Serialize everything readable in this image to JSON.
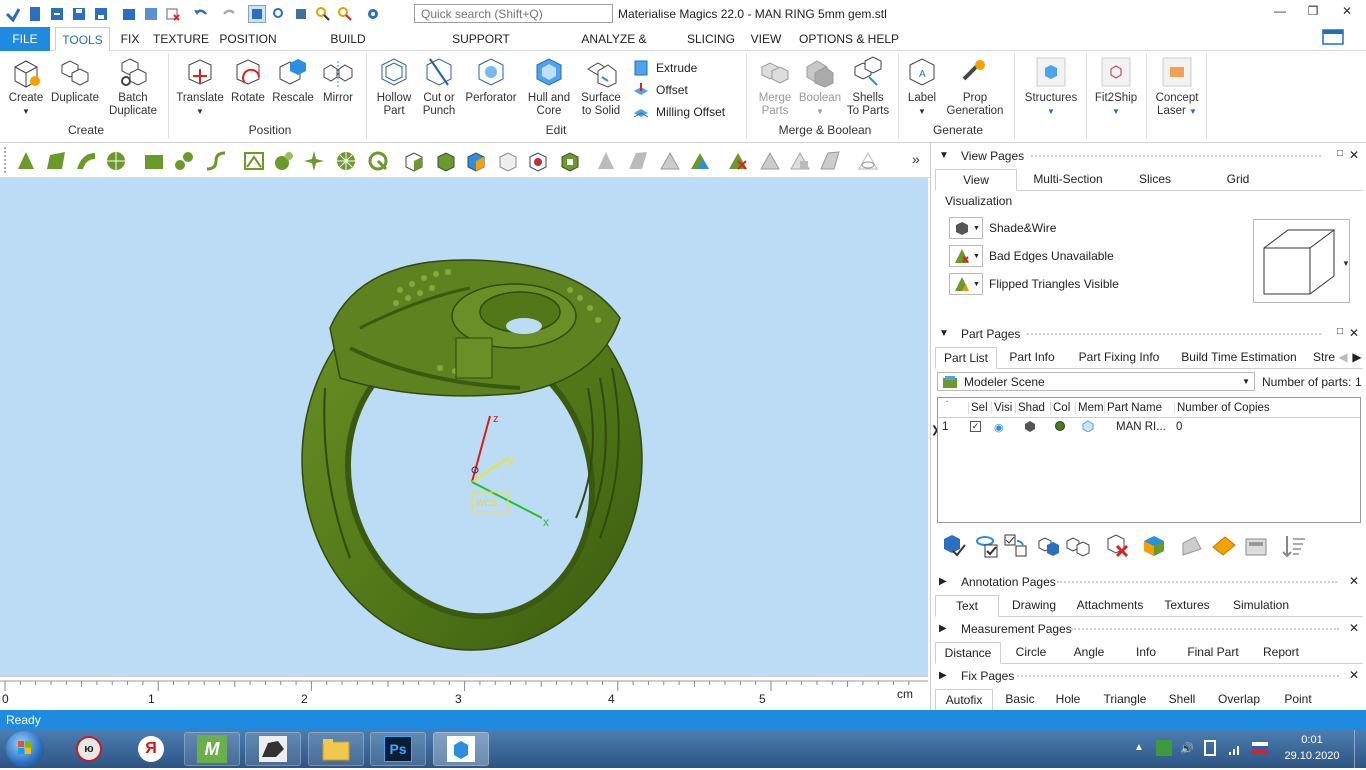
{
  "titlebar": {
    "search_placeholder": "Quick search (Shift+Q)",
    "title": "Materialise Magics 22.0 - MAN RING 5mm gem.stl"
  },
  "menu": {
    "file": "FILE",
    "tabs": [
      "TOOLS",
      "FIX",
      "TEXTURE",
      "POSITION",
      "BUILD PREPARATION",
      "SUPPORT GENERATION",
      "ANALYZE & REPORT",
      "SLICING",
      "VIEW",
      "OPTIONS & HELP"
    ]
  },
  "ribbon": {
    "create": {
      "group": "Create",
      "create": "Create",
      "duplicate": "Duplicate",
      "batch1": "Batch",
      "batch2": "Duplicate"
    },
    "position": {
      "group": "Position",
      "translate": "Translate",
      "rotate": "Rotate",
      "rescale": "Rescale",
      "mirror": "Mirror"
    },
    "edit": {
      "group": "Edit",
      "hollow1": "Hollow",
      "hollow2": "Part",
      "cut1": "Cut or",
      "cut2": "Punch",
      "perforator": "Perforator",
      "hull1": "Hull and",
      "hull2": "Core",
      "surf1": "Surface",
      "surf2": "to Solid",
      "extrude": "Extrude",
      "offset": "Offset",
      "milling": "Milling Offset"
    },
    "merge": {
      "group": "Merge & Boolean",
      "merge1": "Merge",
      "merge2": "Parts",
      "boolean": "Boolean",
      "shells1": "Shells",
      "shells2": "To Parts"
    },
    "generate": {
      "group": "Generate",
      "label": "Label",
      "prop1": "Prop",
      "prop2": "Generation"
    },
    "structures": "Structures",
    "fit2ship": "Fit2Ship",
    "concept1": "Concept",
    "concept2": "Laser"
  },
  "viewport": {
    "axis_x": "x",
    "axis_y": "y",
    "axis_z": "z",
    "wcs": "WCS"
  },
  "ruler": {
    "unit": "cm",
    "ticks": [
      "0",
      "1",
      "2",
      "3",
      "4",
      "5"
    ]
  },
  "view_pages": {
    "title": "View Pages",
    "tabs": [
      "View",
      "Multi-Section",
      "Slices",
      "Grid"
    ],
    "visualization": "Visualization",
    "shade": "Shade&Wire",
    "bad_edges": "Bad Edges Unavailable",
    "flipped": "Flipped Triangles Visible"
  },
  "part_pages": {
    "title": "Part Pages",
    "tabs": [
      "Part List",
      "Part Info",
      "Part Fixing Info",
      "Build Time Estimation",
      "Stre"
    ],
    "scene": "Modeler Scene",
    "num_parts_label": "Number of parts:",
    "num_parts": "1",
    "columns": [
      "Sel",
      "Visi",
      "Shad",
      "Col",
      "Mem",
      "Part Name",
      "Number of Copies"
    ],
    "row": {
      "index": "1",
      "name": "MAN RI...",
      "copies": "0"
    }
  },
  "annotation_pages": {
    "title": "Annotation Pages",
    "tabs": [
      "Text",
      "Drawing",
      "Attachments",
      "Textures",
      "Simulation"
    ]
  },
  "measurement_pages": {
    "title": "Measurement Pages",
    "tabs": [
      "Distance",
      "Circle",
      "Angle",
      "Info",
      "Final Part",
      "Report"
    ]
  },
  "fix_pages": {
    "title": "Fix Pages",
    "tabs": [
      "Autofix",
      "Basic",
      "Hole",
      "Triangle",
      "Shell",
      "Overlap",
      "Point"
    ]
  },
  "status": "Ready",
  "taskbar": {
    "time": "0:01",
    "date": "29.10.2020",
    "lang": "ю"
  },
  "colors": {
    "accent": "#1e8ae0",
    "viewport": "#bcdcf5",
    "ring": "#5a7d1e",
    "ring_dark": "#3f5c12"
  }
}
